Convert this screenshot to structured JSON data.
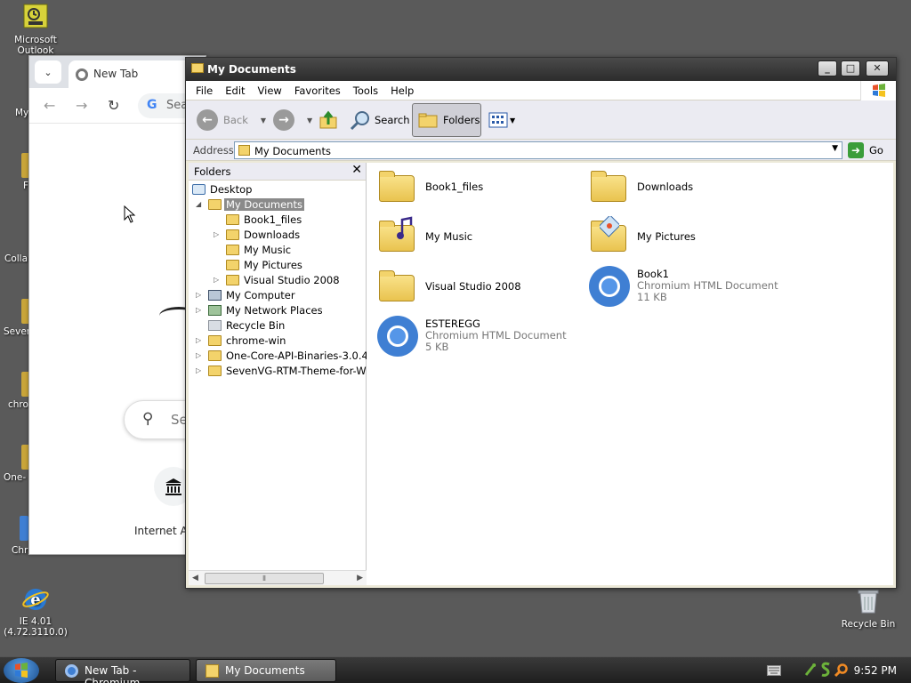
{
  "desktop": {
    "icons": [
      {
        "label": "Microsoft Outlook"
      },
      {
        "label": "IE 4.01 (4.72.3110.0)"
      },
      {
        "label": "Recycle Bin"
      }
    ],
    "partial_labels": [
      "My",
      "F",
      "Colla",
      "Sever",
      "chro",
      "One-",
      "Chr"
    ]
  },
  "chromium": {
    "tab_title": "New Tab",
    "omnibox_text": "Sea",
    "search_placeholder": "Se",
    "shortcut_label": "Internet A"
  },
  "explorer": {
    "title": "My Documents",
    "menu": [
      "File",
      "Edit",
      "View",
      "Favorites",
      "Tools",
      "Help"
    ],
    "toolbar": {
      "back": "Back",
      "search": "Search",
      "folders": "Folders"
    },
    "address": {
      "label": "Address",
      "value": "My Documents",
      "go": "Go"
    },
    "folders_pane": {
      "title": "Folders"
    },
    "tree": [
      {
        "label": "Desktop",
        "level": 0,
        "expander": ""
      },
      {
        "label": "My Documents",
        "level": 1,
        "expander": "open",
        "selected": true
      },
      {
        "label": "Book1_files",
        "level": 2,
        "expander": ""
      },
      {
        "label": "Downloads",
        "level": 2,
        "expander": "closed"
      },
      {
        "label": "My Music",
        "level": 2,
        "expander": ""
      },
      {
        "label": "My Pictures",
        "level": 2,
        "expander": ""
      },
      {
        "label": "Visual Studio 2008",
        "level": 2,
        "expander": "closed"
      },
      {
        "label": "My Computer",
        "level": 1,
        "expander": "closed"
      },
      {
        "label": "My Network Places",
        "level": 1,
        "expander": "closed"
      },
      {
        "label": "Recycle Bin",
        "level": 1,
        "expander": ""
      },
      {
        "label": "chrome-win",
        "level": 1,
        "expander": "closed"
      },
      {
        "label": "One-Core-API-Binaries-3.0.4",
        "level": 1,
        "expander": "closed"
      },
      {
        "label": "SevenVG-RTM-Theme-for-Winc",
        "level": 1,
        "expander": "closed"
      }
    ],
    "files": [
      {
        "name": "Book1_files",
        "type": "",
        "size": "",
        "icon": "folder-icon"
      },
      {
        "name": "Downloads",
        "type": "",
        "size": "",
        "icon": "folder-icon"
      },
      {
        "name": "My Music",
        "type": "",
        "size": "",
        "icon": "music-folder-icon"
      },
      {
        "name": "My Pictures",
        "type": "",
        "size": "",
        "icon": "pictures-folder-icon"
      },
      {
        "name": "Visual Studio 2008",
        "type": "",
        "size": "",
        "icon": "folder-icon"
      },
      {
        "name": "Book1",
        "type": "Chromium HTML Document",
        "size": "11 KB",
        "icon": "chromium-document-icon"
      },
      {
        "name": "ESTEREGG",
        "type": "Chromium HTML Document",
        "size": "5 KB",
        "icon": "chromium-document-icon"
      }
    ]
  },
  "taskbar": {
    "tasks": [
      {
        "label": "New Tab - Chromium"
      },
      {
        "label": "My Documents"
      }
    ],
    "clock": "9:52 PM"
  }
}
